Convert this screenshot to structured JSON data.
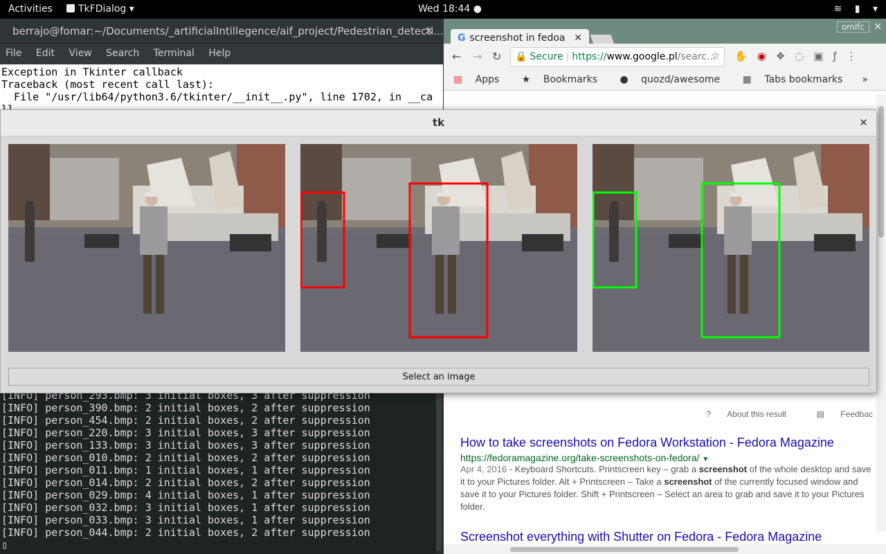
{
  "topbar": {
    "activities": "Activities",
    "app_menu": "TkFDialog",
    "clock": "Wed 18:44"
  },
  "terminal": {
    "title": "berrajo@fomar:~/Documents/_artificialIntillegence/aif_project/Pedestrian_detecti...",
    "menu": [
      "File",
      "Edit",
      "View",
      "Search",
      "Terminal",
      "Help"
    ],
    "top_lines": [
      "Exception in Tkinter callback",
      "Traceback (most recent call last):",
      "  File \"/usr/lib64/python3.6/tkinter/__init__.py\", line 1702, in __ca",
      "ll__"
    ],
    "log_lines": [
      "[INFO] person_293.bmp: 3 initial boxes, 3 after suppression",
      "[INFO] person_390.bmp: 2 initial boxes, 2 after suppression",
      "[INFO] person_454.bmp: 2 initial boxes, 2 after suppression",
      "[INFO] person_220.bmp: 3 initial boxes, 3 after suppression",
      "[INFO] person_133.bmp: 3 initial boxes, 3 after suppression",
      "[INFO] person_010.bmp: 2 initial boxes, 2 after suppression",
      "[INFO] person_011.bmp: 1 initial boxes, 1 after suppression",
      "[INFO] person_014.bmp: 2 initial boxes, 2 after suppression",
      "[INFO] person_029.bmp: 4 initial boxes, 1 after suppression",
      "[INFO] person_032.bmp: 3 initial boxes, 1 after suppression",
      "[INFO] person_033.bmp: 3 initial boxes, 1 after suppression",
      "[INFO] person_044.bmp: 2 initial boxes, 2 after suppression"
    ]
  },
  "browser": {
    "tab_title": "screenshot in fedoa",
    "window_label": "omlfc",
    "omnibox": {
      "secure": "Secure",
      "url_prefix": "https://",
      "url_domain": "www.google.pl",
      "url_rest": "/searc..."
    },
    "bookmarks": [
      "Apps",
      "Bookmarks",
      "quozd/awesome",
      "Tabs bookmarks"
    ],
    "about_result": "About this result",
    "feedback": "Feedbac",
    "results": [
      {
        "title": "How to take screenshots on Fedora Workstation - Fedora Magazine",
        "url": "https://fedoramagazine.org/take-screenshots-on-fedora/",
        "date": "Apr 4, 2016",
        "snippet_1": " - Keyboard Shortcuts. Printscreen key – grab a ",
        "bold_1": "screenshot",
        "snippet_2": " of the whole desktop and save it to your Pictures folder. Alt + Printscreen – Take a ",
        "bold_2": "screenshot",
        "snippet_3": " of the currently focused window and save it to your Pictures folder. Shift + Printscreen – Select an area to grab and save it to your Pictures folder."
      },
      {
        "title": "Screenshot everything with Shutter on Fedora - Fedora Magazine"
      }
    ]
  },
  "tk": {
    "title": "tk",
    "button": "Select an image",
    "box_colors": {
      "panel2": "#ff0000",
      "panel3": "#00ff00"
    }
  }
}
